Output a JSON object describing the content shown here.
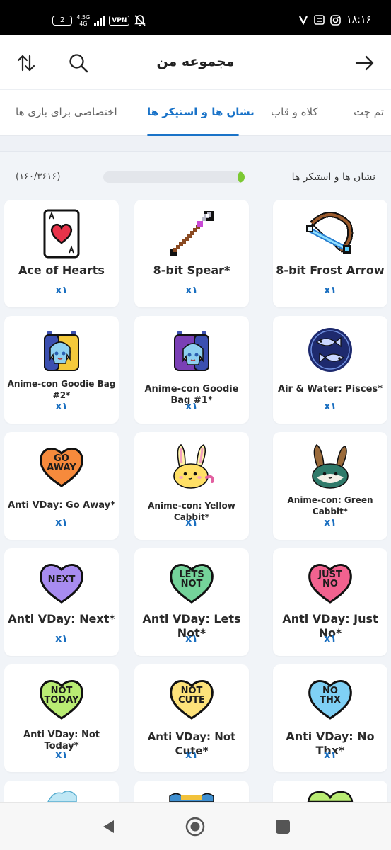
{
  "status_bar": {
    "sim_badge": "2",
    "network_top": "4.5G",
    "network_bottom": "4G",
    "vpn": "VPN",
    "time": "۱۸:۱۶"
  },
  "header": {
    "title": "مجموعه من"
  },
  "tabs": [
    {
      "label": "تم چت"
    },
    {
      "label": "کلاه و قاب"
    },
    {
      "label": "نشان ها و استیکر ها"
    },
    {
      "label": "اختصاصی برای بازی ها"
    }
  ],
  "section": {
    "label": "نشان ها و استیکر ها",
    "count": "(۱۶۰/۳۶۱۶)",
    "progress_fraction": 0.044
  },
  "items": [
    {
      "name": "Ace of Hearts",
      "qty": "x۱",
      "icon": "ace-of-hearts-card"
    },
    {
      "name": "8-bit Spear*",
      "qty": "x۱",
      "icon": "pixel-spear"
    },
    {
      "name": "8-bit Frost Arrow",
      "qty": "x۱",
      "icon": "pixel-crossbow"
    },
    {
      "name": "Anime-con Goodie Bag #2*",
      "qty": "x۱",
      "icon": "goodie-bag-yellow"
    },
    {
      "name": "Anime-con Goodie Bag #1*",
      "qty": "x۱",
      "icon": "goodie-bag-purple"
    },
    {
      "name": "Air & Water: Pisces*",
      "qty": "x۱",
      "icon": "pisces-fish-emblem"
    },
    {
      "name": "Anti VDay: Go Away*",
      "qty": "x۱",
      "icon": "candy-heart",
      "heart_text": "GO\nAWAY",
      "color": "#f68a3c"
    },
    {
      "name": "Anime-con: Yellow Cabbit*",
      "qty": "x۱",
      "icon": "yellow-cabbit"
    },
    {
      "name": "Anime-con: Green Cabbit*",
      "qty": "x۱",
      "icon": "green-cabbit"
    },
    {
      "name": "Anti VDay: Next*",
      "qty": "x۱",
      "icon": "candy-heart",
      "heart_text": "NEXT",
      "color": "#a88cf0"
    },
    {
      "name": "Anti VDay: Lets Not*",
      "qty": "x۱",
      "icon": "candy-heart",
      "heart_text": "LETS\nNOT",
      "color": "#74d39a"
    },
    {
      "name": "Anti VDay: Just No*",
      "qty": "x۱",
      "icon": "candy-heart",
      "heart_text": "JUST\nNO",
      "color": "#f2628f"
    },
    {
      "name": "Anti VDay: Not Today*",
      "qty": "x۱",
      "icon": "candy-heart",
      "heart_text": "NOT\nTODAY",
      "color": "#b9ec73"
    },
    {
      "name": "Anti VDay: Not Cute*",
      "qty": "x۱",
      "icon": "candy-heart",
      "heart_text": "NOT\nCUTE",
      "color": "#fde27a"
    },
    {
      "name": "Anti VDay: No Thx*",
      "qty": "x۱",
      "icon": "candy-heart",
      "heart_text": "NO\nTHX",
      "color": "#7fd0f5"
    }
  ]
}
